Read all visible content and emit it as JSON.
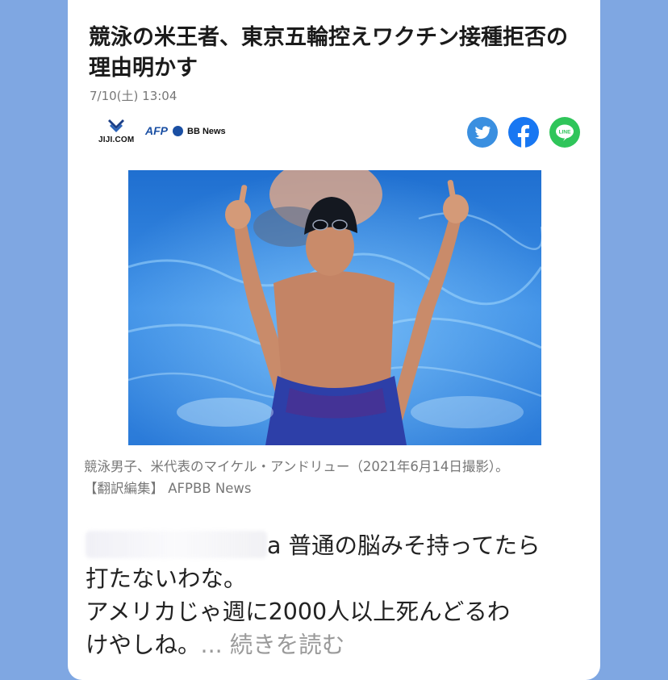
{
  "article": {
    "title": "競泳の米王者、東京五輪控えワクチン接種拒否の理由明かす",
    "date": "7/10(土) 13:04"
  },
  "sources": {
    "jiji": "JIJI.COM",
    "afp": "AFP",
    "bb": "BB News"
  },
  "share": {
    "twitter_color": "#3a8fe0",
    "facebook_color": "#1877f2",
    "line_color": "#2fc55a",
    "line_label": "LINE"
  },
  "caption": {
    "line1": "競泳男子、米代表のマイケル・アンドリュー（2021年6月14日撮影）。",
    "line2": "【翻訳編集】 AFPBB News"
  },
  "comment": {
    "line1_tail": "a 普通の脳みそ持ってたら",
    "line2": "打たないわな。",
    "line3": "アメリカじゃ週に2000人以上死んどるわ",
    "line4": "けやしね。",
    "more": "... 続きを読む"
  }
}
